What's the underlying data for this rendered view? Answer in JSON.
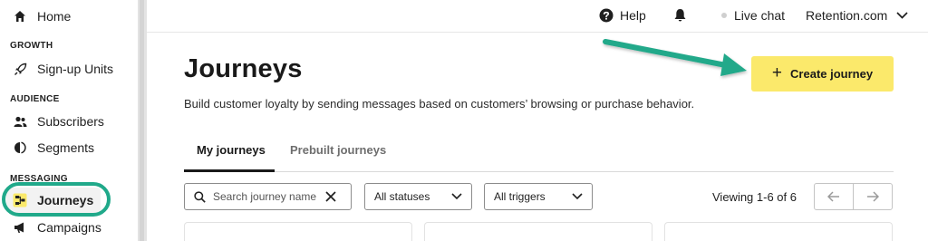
{
  "sidebar": {
    "home": {
      "label": "Home",
      "icon": "home-icon"
    },
    "sections": [
      {
        "title": "GROWTH",
        "items": [
          {
            "label": "Sign-up Units",
            "icon": "rocket-icon"
          }
        ]
      },
      {
        "title": "AUDIENCE",
        "items": [
          {
            "label": "Subscribers",
            "icon": "users-icon"
          },
          {
            "label": "Segments",
            "icon": "segments-icon"
          }
        ]
      },
      {
        "title": "MESSAGING",
        "items": [
          {
            "label": "Journeys",
            "icon": "journeys-icon",
            "active": true
          },
          {
            "label": "Campaigns",
            "icon": "megaphone-icon"
          }
        ]
      }
    ]
  },
  "topbar": {
    "help_label": "Help",
    "live_chat_label": "Live chat",
    "account_label": "Retention.com"
  },
  "main": {
    "title": "Journeys",
    "subtitle": "Build customer loyalty by sending messages based on customers’ browsing or purchase behavior.",
    "create_button_label": "Create journey",
    "tabs": [
      {
        "label": "My journeys",
        "active": true
      },
      {
        "label": "Prebuilt journeys",
        "active": false
      }
    ],
    "filters": {
      "search_placeholder": "Search journey name",
      "status_select": "All statuses",
      "trigger_select": "All triggers"
    },
    "viewing_text": "Viewing 1-6 of 6"
  },
  "colors": {
    "accent_button": "#fbe96b",
    "annotation_teal": "#20a98a"
  }
}
